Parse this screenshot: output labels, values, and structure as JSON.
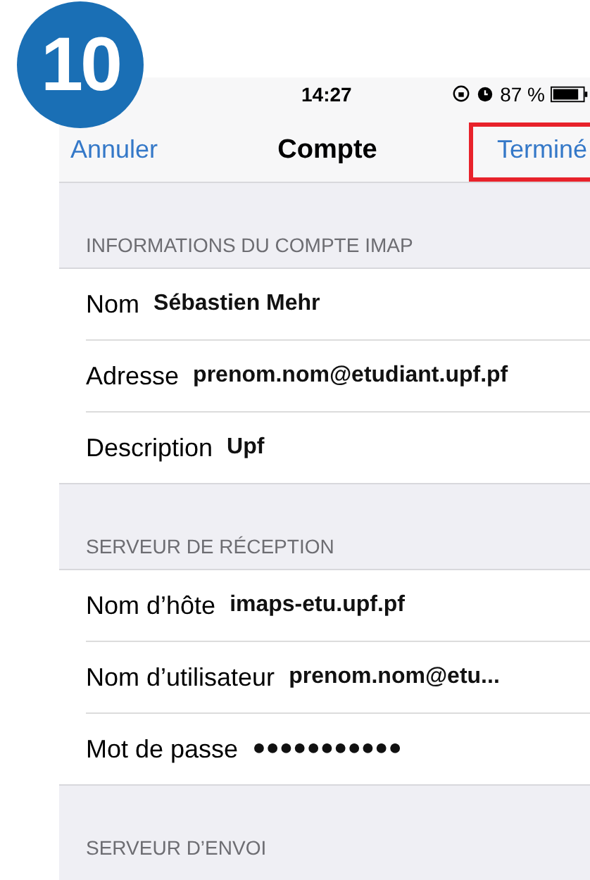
{
  "step_badge": "10",
  "status_bar": {
    "time": "14:27",
    "battery": "87 %"
  },
  "nav": {
    "cancel": "Annuler",
    "title": "Compte",
    "done": "Terminé",
    "done_highlighted": true
  },
  "sections": [
    {
      "header": "INFORMATIONS DU COMPTE IMAP",
      "rows": [
        {
          "label": "Nom",
          "value": "Sébastien Mehr"
        },
        {
          "label": "Adresse",
          "value": "prenom.nom@etudiant.upf.pf"
        },
        {
          "label": "Description",
          "value": "Upf"
        }
      ]
    },
    {
      "header": "SERVEUR DE RÉCEPTION",
      "rows": [
        {
          "label": "Nom d’hôte",
          "value": "imaps-etu.upf.pf"
        },
        {
          "label": "Nom d’utilisateur",
          "value": "prenom.nom@etu..."
        },
        {
          "label": "Mot de passe",
          "value": "●●●●●●●●●●●"
        }
      ]
    },
    {
      "header": "SERVEUR D’ENVOI"
    }
  ]
}
